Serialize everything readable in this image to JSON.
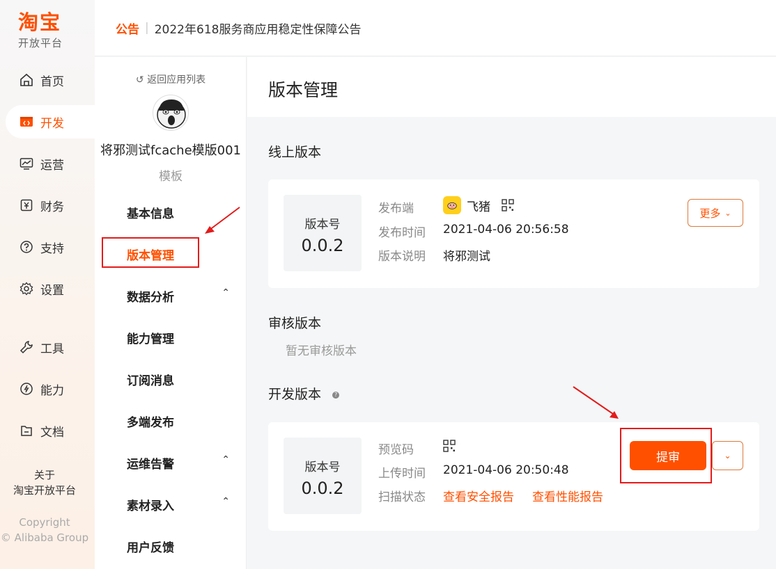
{
  "brand": {
    "logo": "淘宝",
    "subtitle": "开放平台",
    "accent": "#ff5000"
  },
  "nav": {
    "items": [
      {
        "label": "首页",
        "icon": "home-icon"
      },
      {
        "label": "开发",
        "icon": "code-icon",
        "active": true
      },
      {
        "label": "运营",
        "icon": "chart-monitor-icon"
      },
      {
        "label": "财务",
        "icon": "yuan-icon"
      },
      {
        "label": "支持",
        "icon": "help-icon"
      },
      {
        "label": "设置",
        "icon": "gear-icon"
      },
      {
        "label": "工具",
        "icon": "wrench-icon"
      },
      {
        "label": "能力",
        "icon": "capability-icon"
      },
      {
        "label": "文档",
        "icon": "document-icon"
      }
    ],
    "about_line1": "关于",
    "about_line2": "淘宝开放平台",
    "copyright_line1": "Copyright",
    "copyright_line2": "© Alibaba Group"
  },
  "notice": {
    "tag": "公告",
    "separator": "|",
    "text": "2022年618服务商应用稳定性保障公告"
  },
  "sidebar": {
    "back_label": "返回应用列表",
    "app_name": "将邪测试fcache模版001",
    "app_type": "模板",
    "menu": [
      {
        "label": "基本信息"
      },
      {
        "label": "版本管理",
        "active": true
      },
      {
        "label": "数据分析",
        "caret": "⌃"
      },
      {
        "label": "能力管理"
      },
      {
        "label": "订阅消息"
      },
      {
        "label": "多端发布"
      },
      {
        "label": "运维告警",
        "caret": "⌃"
      },
      {
        "label": "素材录入",
        "caret": "⌃"
      },
      {
        "label": "用户反馈"
      }
    ]
  },
  "main": {
    "title": "版本管理",
    "online": {
      "section_title": "线上版本",
      "version_label": "版本号",
      "version": "0.0.2",
      "platform_label": "发布端",
      "platform_name": "飞猪",
      "time_label": "发布时间",
      "time": "2021-04-06 20:56:58",
      "desc_label": "版本说明",
      "desc": "将邪测试",
      "more_button": "更多",
      "more_caret": "⌄"
    },
    "review": {
      "section_title": "审核版本",
      "empty_text": "暂无审核版本"
    },
    "dev": {
      "section_title": "开发版本",
      "info_mark": "?",
      "version_label": "版本号",
      "version": "0.0.2",
      "preview_label": "预览码",
      "upload_label": "上传时间",
      "upload_time": "2021-04-06 20:50:48",
      "scan_label": "扫描状态",
      "security_report_link": "查看安全报告",
      "performance_report_link": "查看性能报告",
      "submit_button": "提审",
      "dropdown_caret": "⌄"
    }
  }
}
